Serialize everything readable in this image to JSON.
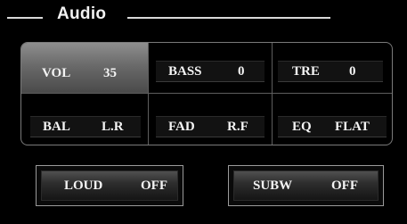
{
  "header": {
    "title": "Audio"
  },
  "grid": {
    "vol": {
      "label": "VOL",
      "value": "35",
      "selected": true
    },
    "bass": {
      "label": "BASS",
      "value": "0"
    },
    "tre": {
      "label": "TRE",
      "value": "0"
    },
    "bal": {
      "label": "BAL",
      "value": "L.R"
    },
    "fad": {
      "label": "FAD",
      "value": "R.F"
    },
    "eq": {
      "label": "EQ",
      "value": "FLAT"
    }
  },
  "buttons": {
    "loud": {
      "label": "LOUD",
      "value": "OFF"
    },
    "subw": {
      "label": "SUBW",
      "value": "OFF"
    }
  },
  "colors": {
    "background": "#000000",
    "text": "#f4f4f4",
    "selected_cell": "#7a7a7a",
    "border": "#7a7a7a"
  }
}
